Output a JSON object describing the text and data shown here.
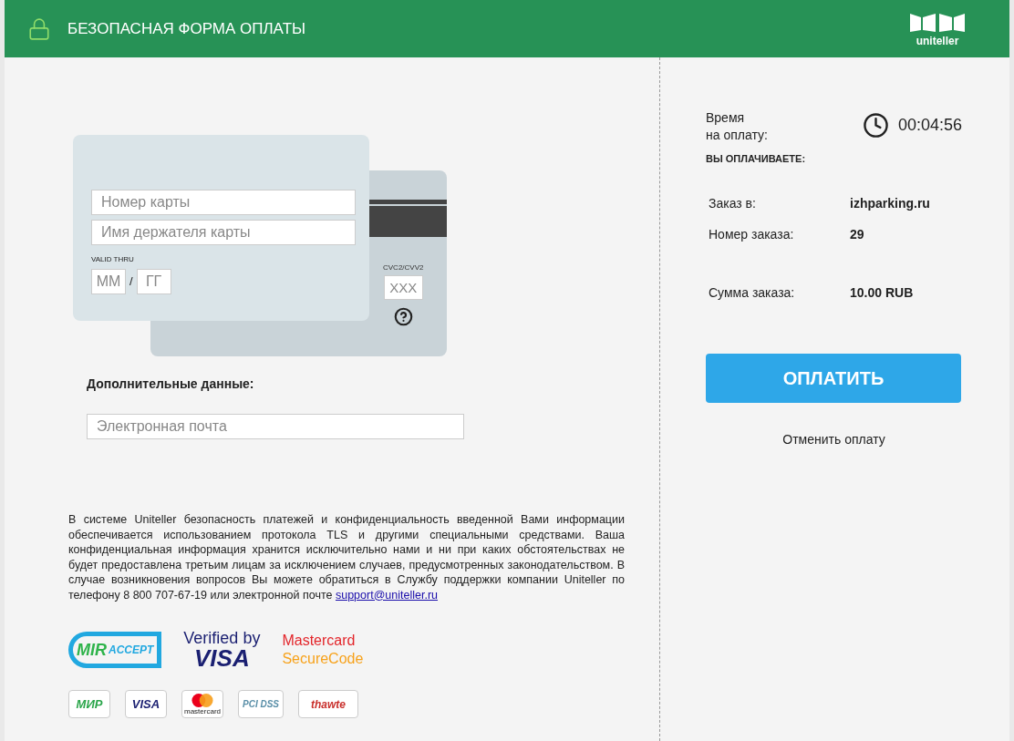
{
  "header": {
    "title": "БЕЗОПАСНАЯ ФОРМА ОПЛАТЫ",
    "logo_text": "uniteller"
  },
  "card": {
    "number_placeholder": "Номер карты",
    "holder_placeholder": "Имя держателя карты",
    "valid_label": "VALID THRU",
    "month_placeholder": "ММ",
    "separator": "/",
    "year_placeholder": "ГГ",
    "cvc_label": "CVC2/CVV2",
    "cvc_placeholder": "XXX"
  },
  "extra": {
    "title": "Дополнительные данные:",
    "email_placeholder": "Электронная почта"
  },
  "notice": {
    "text": "В системе Uniteller безопасность платежей и конфиденциальность введенной Вами информации обеспечивается использованием протокола TLS и другими специальными средствами. Ваша конфиденциальная информация хранится исключительно нами и ни при каких обстоятельствах не будет предоставлена третьим лицам за исключением случаев, предусмотренных законодательством. В случае возникновения вопросов Вы можете обратиться в Службу поддержки компании Uniteller по телефону 8 800 707-67-19 или электронной почте",
    "link": "support@uniteller.ru"
  },
  "security_logos": [
    {
      "kind": "mir-accept",
      "lines": [
        "MIR",
        "ACCEPT"
      ]
    },
    {
      "kind": "verified",
      "lines": [
        "Verified by",
        "VISA"
      ]
    },
    {
      "kind": "securecode",
      "lines": [
        "Mastercard",
        "SecureCode"
      ]
    }
  ],
  "payment_badges": [
    {
      "kind": "mir",
      "label": "МИР"
    },
    {
      "kind": "visa",
      "label": "VISA"
    },
    {
      "kind": "mastercard",
      "label": "mastercard"
    },
    {
      "kind": "pci",
      "label": "PCI DSS"
    },
    {
      "kind": "thawte",
      "label": "thawte"
    }
  ],
  "timer": {
    "label_lines": [
      "Время",
      "на оплату:"
    ],
    "value": "00:04:56"
  },
  "summary_title": "ВЫ ОПЛАЧИВАЕТЕ:",
  "order_rows": [
    {
      "label": "Заказ в:",
      "value": "izhparking.ru"
    },
    {
      "label": "Номер заказа:",
      "value": "29"
    },
    {
      "label": "Сумма заказа:",
      "value": "10.00 RUB"
    }
  ],
  "pay_button": "ОПЛАТИТЬ",
  "cancel_link": "Отменить оплату"
}
